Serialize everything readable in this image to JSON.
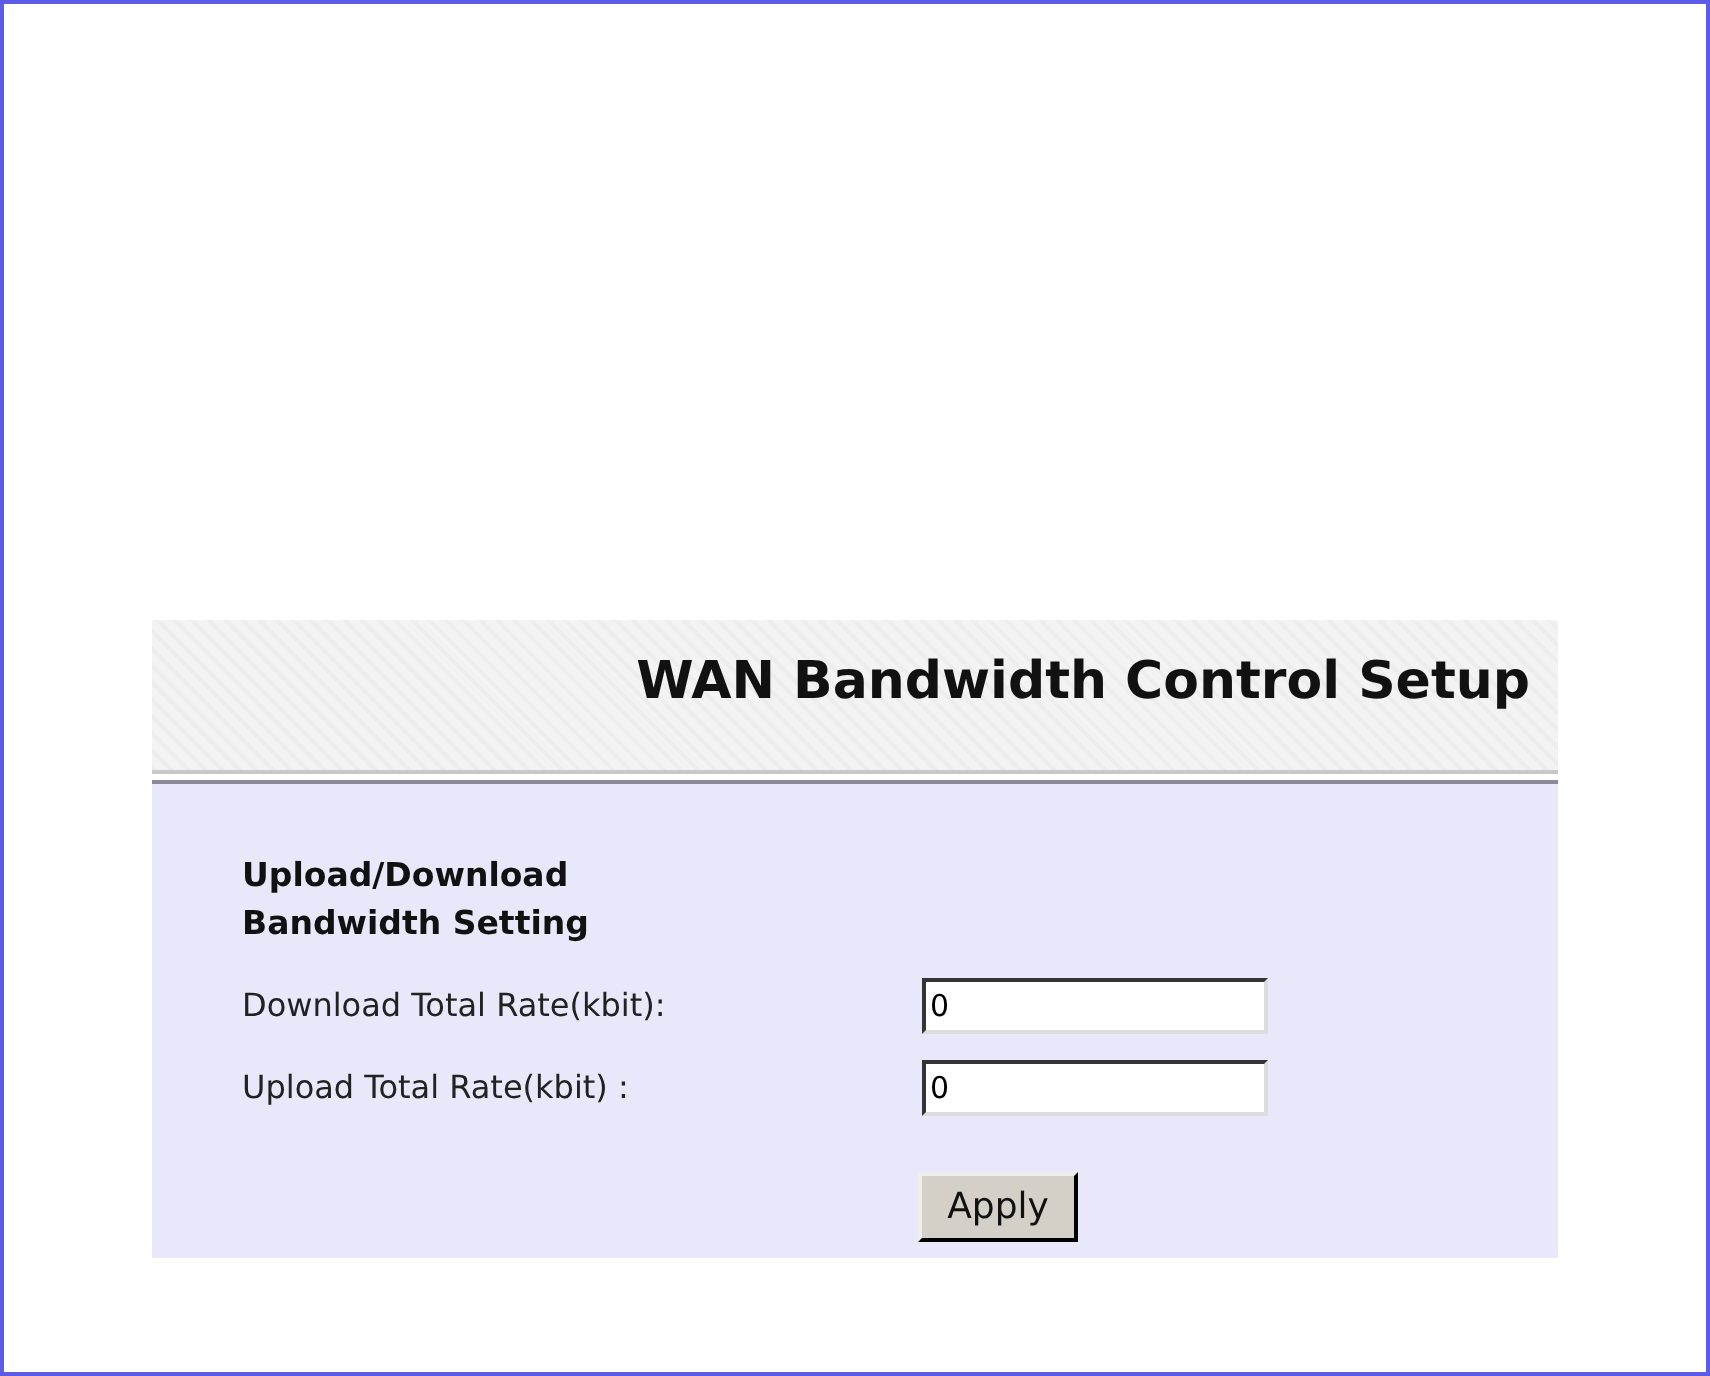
{
  "header": {
    "title": "WAN Bandwidth Control Setup"
  },
  "section": {
    "heading": "Upload/Download Bandwidth Setting"
  },
  "fields": [
    {
      "label": "Download Total Rate(kbit):",
      "value": "0"
    },
    {
      "label": "Upload Total Rate(kbit) :",
      "value": "0"
    }
  ],
  "buttons": [
    "Apply"
  ]
}
